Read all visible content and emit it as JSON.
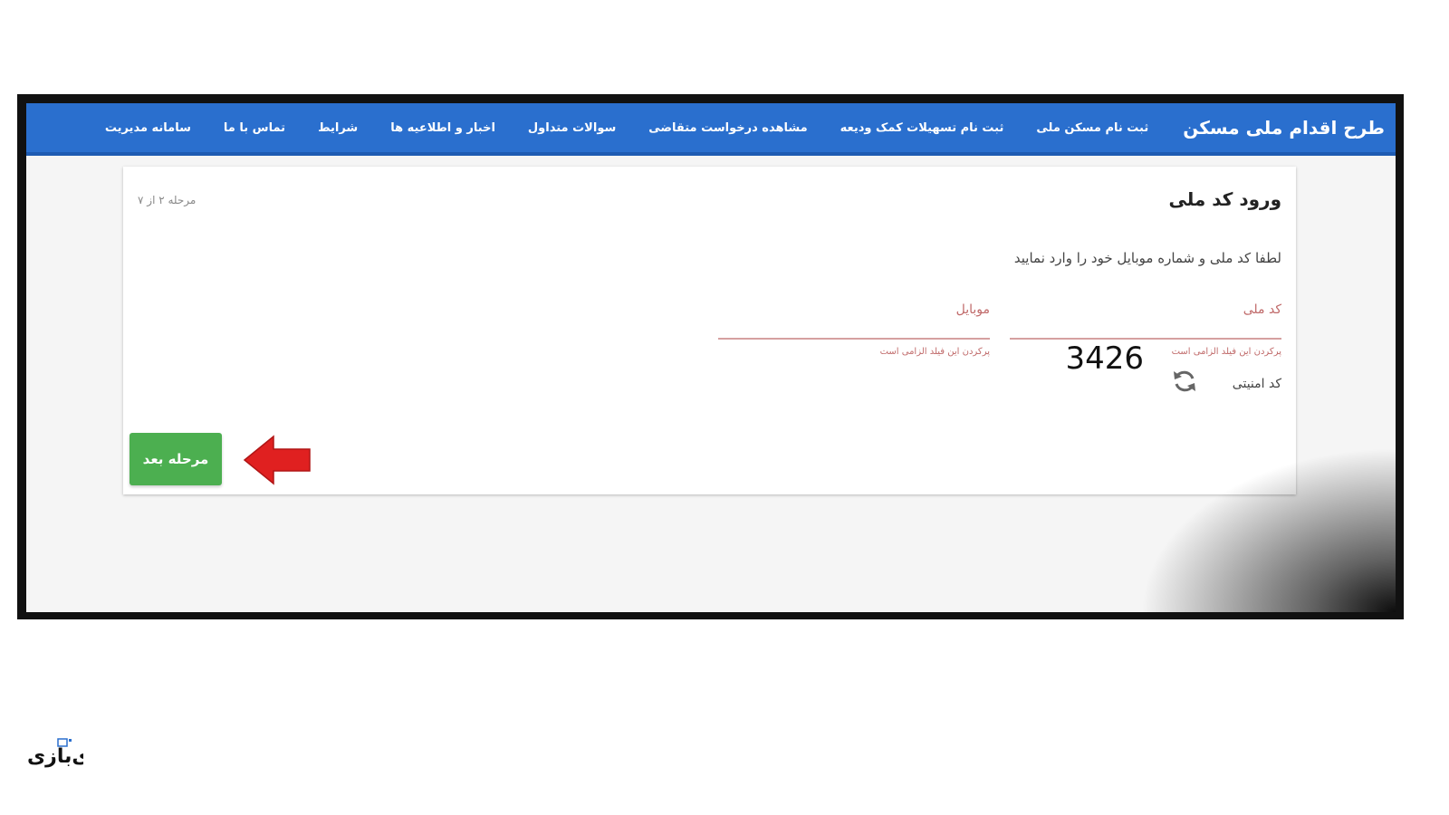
{
  "navbar": {
    "brand": "طرح اقدام ملی مسکن",
    "items": [
      {
        "label": "ثبت نام مسکن ملی"
      },
      {
        "label": "ثبت نام تسهیلات کمک ودیعه"
      },
      {
        "label": "مشاهده درخواست متقاضی"
      },
      {
        "label": "سوالات متداول"
      },
      {
        "label": "اخبار و اطلاعیه ها"
      },
      {
        "label": "شرایط"
      },
      {
        "label": "تماس با ما"
      },
      {
        "label": "سامانه مدیریت"
      }
    ]
  },
  "card": {
    "title": "ورود کد ملی",
    "step": "مرحله ۲ از ۷",
    "instruction": "لطفا کد ملی و شماره موبایل خود را وارد نمایید",
    "fields": {
      "national_code": {
        "label": "کد ملی",
        "value": "",
        "error": "پرکردن این فیلد الزامی است"
      },
      "mobile": {
        "label": "موبایل",
        "value": "",
        "error": "پرکردن این فیلد الزامی است"
      }
    },
    "captcha": {
      "label": "کد امنیتی",
      "code": "3426"
    },
    "next_button": "مرحله بعد"
  },
  "watermark": {
    "text": "ای بازی"
  },
  "colors": {
    "navbar": "#2a6fce",
    "button": "#4caf50",
    "arrow": "#e02020",
    "error": "#c06a6a"
  }
}
